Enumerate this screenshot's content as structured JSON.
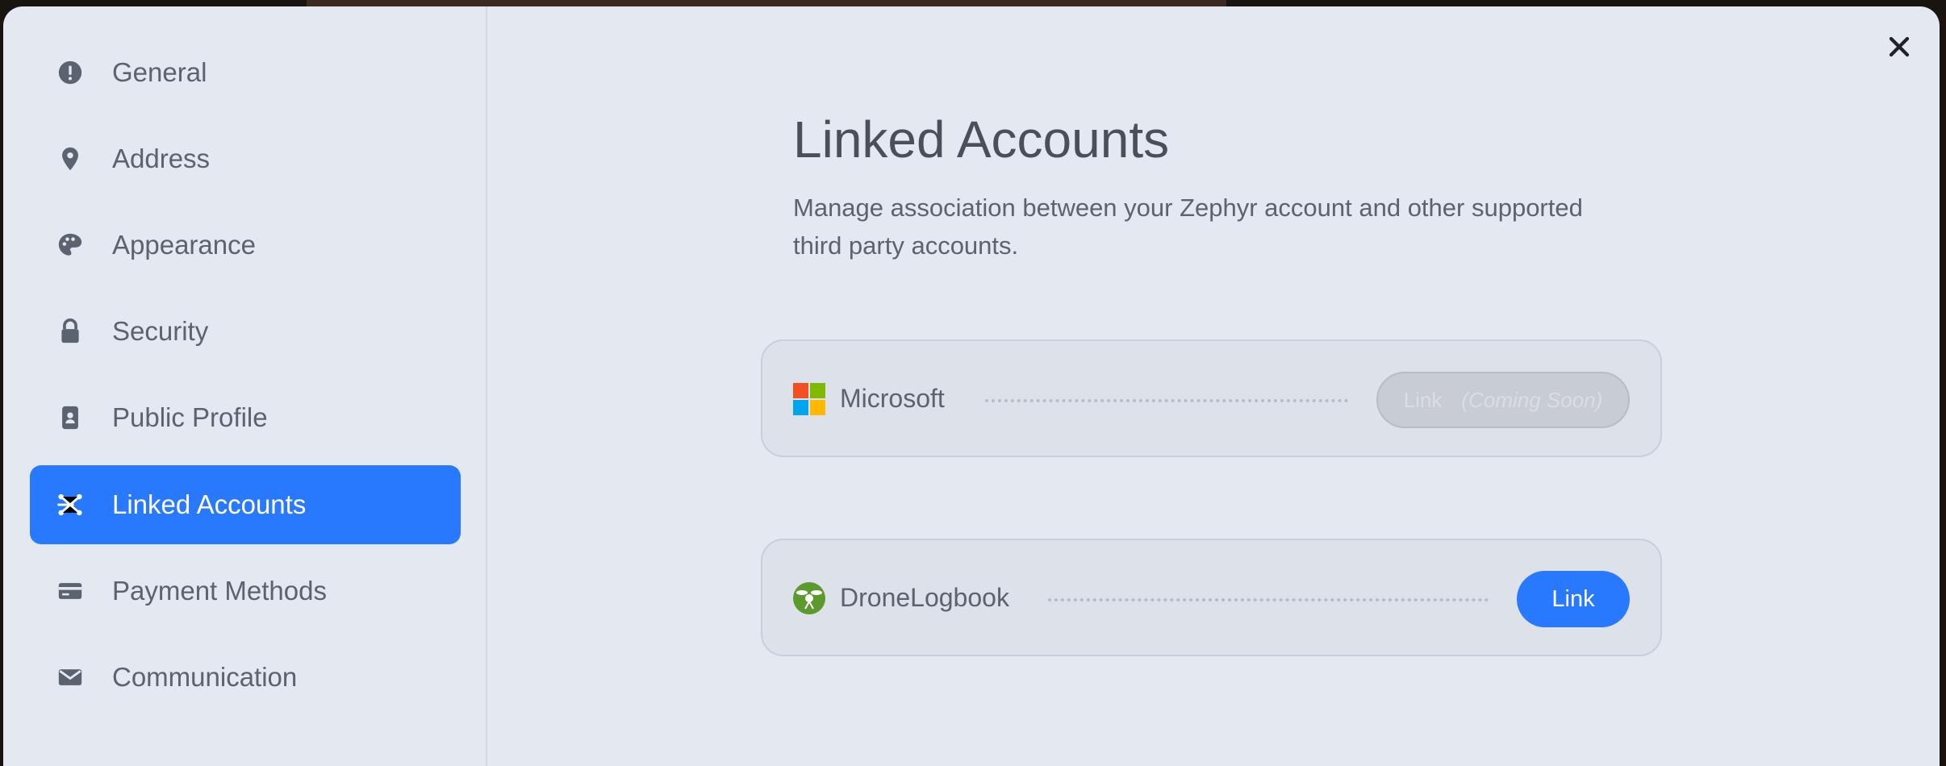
{
  "sidebar": {
    "items": [
      {
        "label": "General",
        "icon": "info-circle-icon"
      },
      {
        "label": "Address",
        "icon": "map-pin-icon"
      },
      {
        "label": "Appearance",
        "icon": "palette-icon"
      },
      {
        "label": "Security",
        "icon": "lock-icon"
      },
      {
        "label": "Public Profile",
        "icon": "id-badge-icon"
      },
      {
        "label": "Linked Accounts",
        "icon": "link-network-icon",
        "active": true
      },
      {
        "label": "Payment Methods",
        "icon": "credit-card-icon"
      },
      {
        "label": "Communication",
        "icon": "envelope-icon"
      }
    ]
  },
  "main": {
    "title": "Linked Accounts",
    "description": "Manage association between your Zephyr account and other supported third party accounts.",
    "accounts": [
      {
        "name": "Microsoft",
        "button_label": "Link",
        "button_note": "(Coming Soon)",
        "enabled": false
      },
      {
        "name": "DroneLogbook",
        "button_label": "Link",
        "enabled": true
      }
    ]
  },
  "colors": {
    "accent": "#2979ff",
    "background": "#e4e8f0",
    "text": "#5b6270"
  }
}
